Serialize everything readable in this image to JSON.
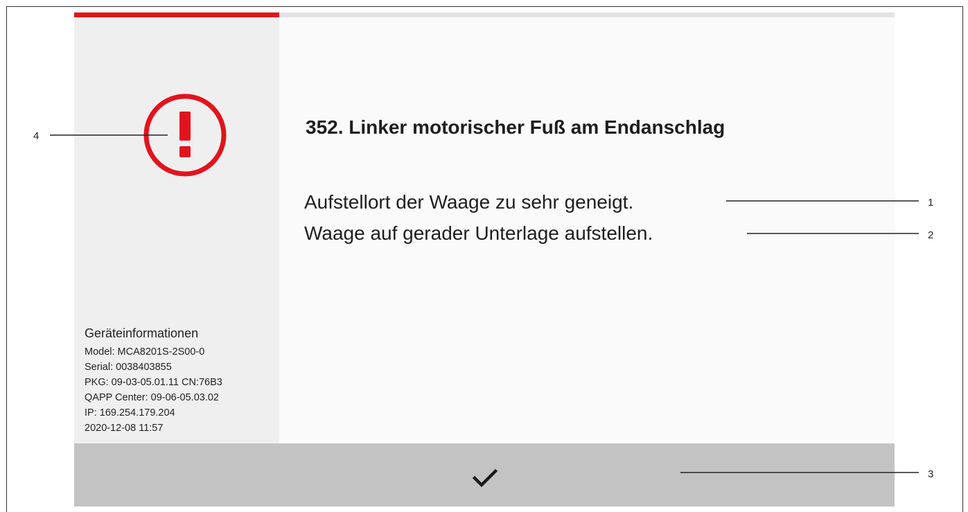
{
  "progress": {
    "fraction": 0.25,
    "fill_color": "#e1141e",
    "track_color": "#e3e3e3"
  },
  "alert": {
    "icon": "exclamation-circle-icon",
    "icon_color": "#e1141e",
    "title": "352. Linker motorischer Fuß am Endanschlag",
    "messages": [
      "Aufstellort der Waage zu sehr geneigt.",
      "Waage auf gerader Unterlage aufstellen."
    ]
  },
  "device_info": {
    "heading": "Geräteinformationen",
    "rows": [
      "Model: MCA8201S-2S00-0",
      "Serial: 0038403855",
      "PKG: 09-03-05.01.11 CN:76B3",
      "QAPP Center: 09-06-05.03.02",
      "IP: 169.254.179.204",
      "2020-12-08 11:57"
    ]
  },
  "footer": {
    "confirm_icon": "checkmark-icon"
  },
  "callouts": {
    "c1": "1",
    "c2": "2",
    "c3": "3",
    "c4": "4"
  }
}
